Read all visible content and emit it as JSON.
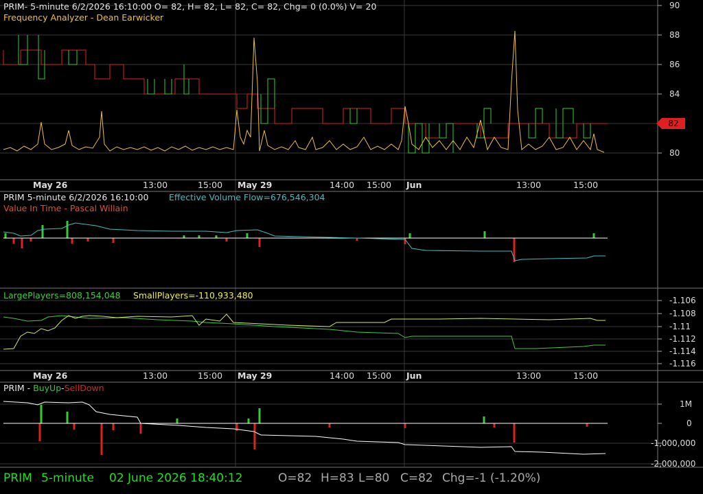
{
  "panel1": {
    "title": "PRIM- 5-minute 6/2/2026 16:10:00 O= 82, H= 82, L= 82, C= 82, Chg= 0 (0.0%) V= 20",
    "indicator": "Frequency Analyzer - Dean Earwicker",
    "last_price": "82",
    "y_ticks": [
      "90",
      "88",
      "86",
      "84",
      "82",
      "80"
    ]
  },
  "date_axis_top": {
    "labels": [
      "May 26",
      "13:00",
      "15:00",
      "May 29",
      "14:00",
      "15:00",
      "Jun",
      "13:00",
      "15:00"
    ]
  },
  "panel2": {
    "symbol": "PRIM 5-minute  6/2/2026 16:10:00",
    "evf": "Effective Volume Flow=676,546,304",
    "indicator": "Value In Time - Pascal Willain"
  },
  "panel3": {
    "large": "LargePlayers=808,154,048",
    "small": "SmallPlayers=-110,933,480",
    "y_ticks": [
      "-1.106",
      "-1.108",
      "-1.11",
      "-1.112",
      "-1.114",
      "-1.116"
    ]
  },
  "date_axis_bottom": {
    "labels": [
      "May 26",
      "13:00",
      "15:00",
      "May 29",
      "14:00",
      "15:00",
      "Jun",
      "13:00",
      "15:00"
    ]
  },
  "panel4": {
    "prefix": "PRIM - ",
    "buyup": "BuyUp",
    "dash": "-",
    "selldown": "SellDown",
    "y_ticks": [
      "1M",
      "0",
      "-1,000,000",
      "-2,000,000"
    ]
  },
  "statusbar": {
    "symbol": "PRIM",
    "interval": "5-minute",
    "datetime": "02 June 2026 18:40:12",
    "open": "O=82",
    "high": "H=83",
    "low": "L=80",
    "close": "C=82",
    "change": "Chg=-1 (-1.20%)"
  },
  "colors": {
    "bull": "#33cc33",
    "bear": "#dd2222",
    "yellow": "#f0c040",
    "cyan": "#40c0c0",
    "light_green": "#ccee66",
    "white": "#ffffff",
    "status_green": "#22dd22",
    "status_grey": "#aaaaaa"
  }
}
